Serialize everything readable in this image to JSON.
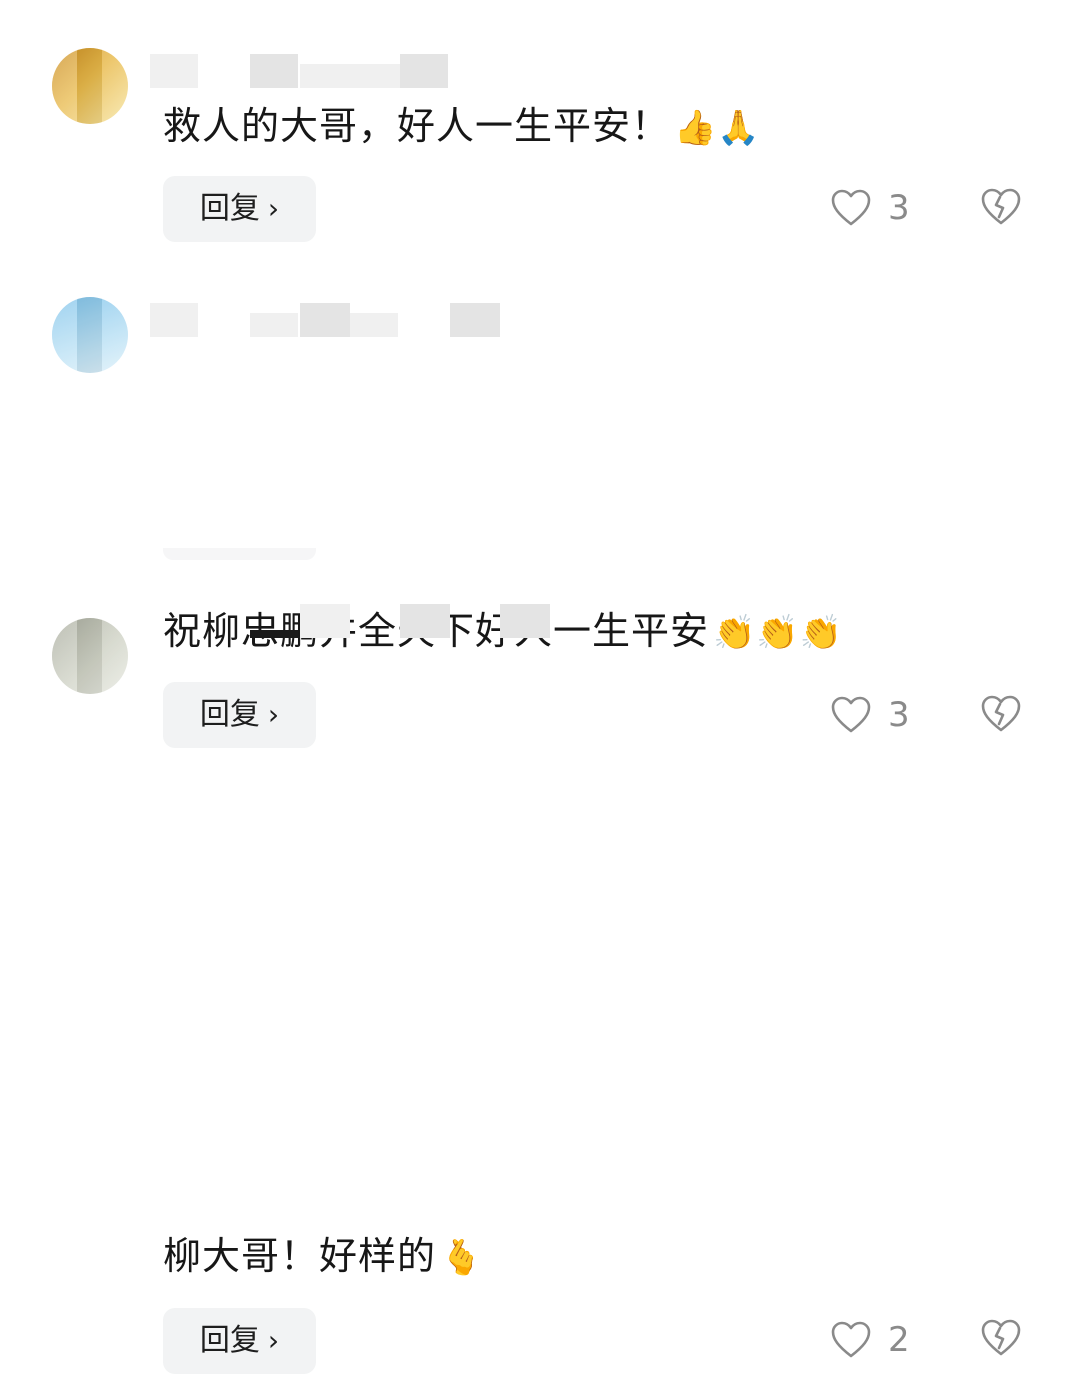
{
  "comments": [
    {
      "text": "救人的大哥，好人一生平安！",
      "emojis": "👍🙏",
      "reply_label": "回复",
      "likes": "3",
      "icons": {
        "like": "heart-outline-icon",
        "dislike": "broken-heart-icon",
        "reply": "chevron-right-icon"
      }
    },
    {
      "text": "祝柳忠鹏并全天下好人一生平安",
      "emojis": "👏👏👏",
      "reply_label": "回复",
      "likes": "3",
      "icons": {
        "like": "heart-outline-icon",
        "dislike": "broken-heart-icon",
        "reply": "chevron-right-icon"
      }
    },
    {
      "text": "柳大哥！好样的",
      "emojis": "🫰",
      "reply_label": "回复",
      "likes": "2",
      "icons": {
        "like": "heart-outline-icon",
        "dislike": "broken-heart-icon",
        "reply": "chevron-right-icon"
      }
    }
  ],
  "colors": {
    "background": "#ffffff",
    "text": "#171717",
    "reply_bg": "#f2f3f4",
    "icon_gray": "#8a8a8a"
  }
}
